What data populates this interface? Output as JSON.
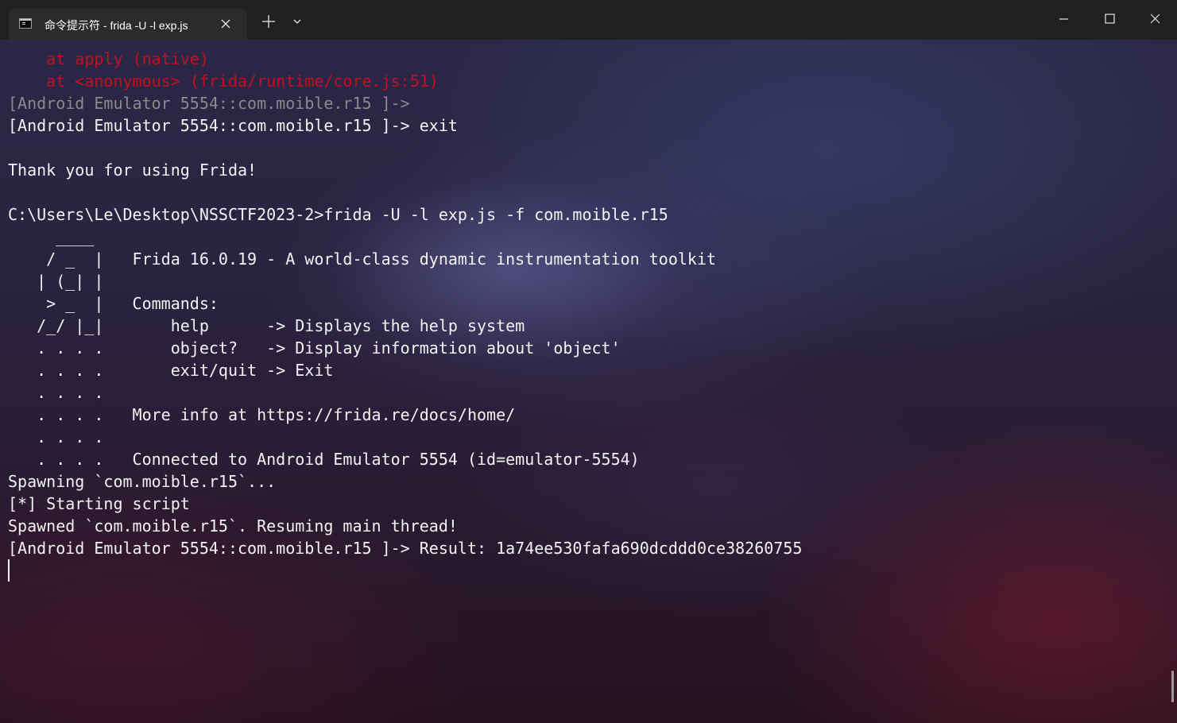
{
  "titlebar": {
    "tab_title": "命令提示符 - frida  -U -l exp.js",
    "tab_icon": "terminal-icon",
    "tab_close_icon": "close-icon",
    "new_tab_icon": "plus-icon",
    "dropdown_icon": "chevron-down-icon",
    "minimize_icon": "minimize-icon",
    "maximize_icon": "maximize-icon",
    "close_icon": "close-icon"
  },
  "colors": {
    "titlebar_bg": "#202020",
    "tab_bg": "#2b2b2b",
    "text": "#f2f2f2",
    "error_text": "#c50f1f",
    "dim_text": "#8a8a8a"
  },
  "terminal": {
    "lines": [
      {
        "text": "    at apply (native)",
        "style": "err"
      },
      {
        "text": "    at <anonymous> (frida/runtime/core.js:51)",
        "style": "err"
      },
      {
        "text": "[Android Emulator 5554::com.moible.r15 ]->",
        "style": "dim"
      },
      {
        "text": "[Android Emulator 5554::com.moible.r15 ]-> exit",
        "style": "normal"
      },
      {
        "text": "",
        "style": "normal"
      },
      {
        "text": "Thank you for using Frida!",
        "style": "normal"
      },
      {
        "text": "",
        "style": "normal"
      },
      {
        "text": "C:\\Users\\Le\\Desktop\\NSSCTF2023-2>frida -U -l exp.js -f com.moible.r15",
        "style": "normal"
      },
      {
        "text": "     ____",
        "style": "normal"
      },
      {
        "text": "    / _  |   Frida 16.0.19 - A world-class dynamic instrumentation toolkit",
        "style": "normal"
      },
      {
        "text": "   | (_| |",
        "style": "normal"
      },
      {
        "text": "    > _  |   Commands:",
        "style": "normal"
      },
      {
        "text": "   /_/ |_|       help      -> Displays the help system",
        "style": "normal"
      },
      {
        "text": "   . . . .       object?   -> Display information about 'object'",
        "style": "normal"
      },
      {
        "text": "   . . . .       exit/quit -> Exit",
        "style": "normal"
      },
      {
        "text": "   . . . .",
        "style": "normal"
      },
      {
        "text": "   . . . .   More info at https://frida.re/docs/home/",
        "style": "normal"
      },
      {
        "text": "   . . . .",
        "style": "normal"
      },
      {
        "text": "   . . . .   Connected to Android Emulator 5554 (id=emulator-5554)",
        "style": "normal"
      },
      {
        "text": "Spawning `com.moible.r15`...",
        "style": "normal"
      },
      {
        "text": "[*] Starting script",
        "style": "normal"
      },
      {
        "text": "Spawned `com.moible.r15`. Resuming main thread!",
        "style": "normal"
      },
      {
        "text": "[Android Emulator 5554::com.moible.r15 ]-> Result: 1a74ee530fafa690dcddd0ce38260755",
        "style": "normal"
      }
    ]
  }
}
